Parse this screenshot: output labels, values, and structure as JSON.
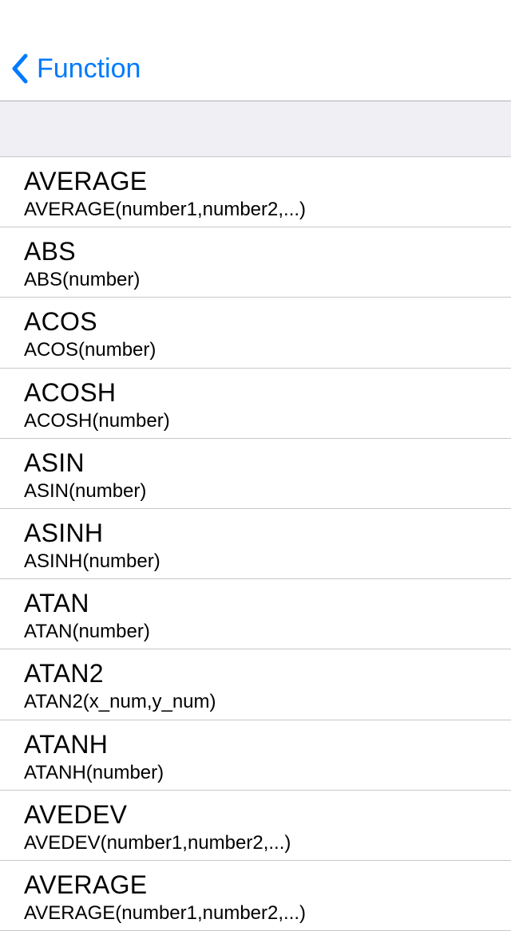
{
  "nav": {
    "back_label": "Function"
  },
  "functions": [
    {
      "name": "AVERAGE",
      "signature": "AVERAGE(number1,number2,...)"
    },
    {
      "name": "ABS",
      "signature": "ABS(number)"
    },
    {
      "name": "ACOS",
      "signature": "ACOS(number)"
    },
    {
      "name": "ACOSH",
      "signature": "ACOSH(number)"
    },
    {
      "name": "ASIN",
      "signature": "ASIN(number)"
    },
    {
      "name": "ASINH",
      "signature": "ASINH(number)"
    },
    {
      "name": "ATAN",
      "signature": "ATAN(number)"
    },
    {
      "name": "ATAN2",
      "signature": "ATAN2(x_num,y_num)"
    },
    {
      "name": "ATANH",
      "signature": "ATANH(number)"
    },
    {
      "name": "AVEDEV",
      "signature": "AVEDEV(number1,number2,...)"
    },
    {
      "name": "AVERAGE",
      "signature": "AVERAGE(number1,number2,...)"
    }
  ]
}
